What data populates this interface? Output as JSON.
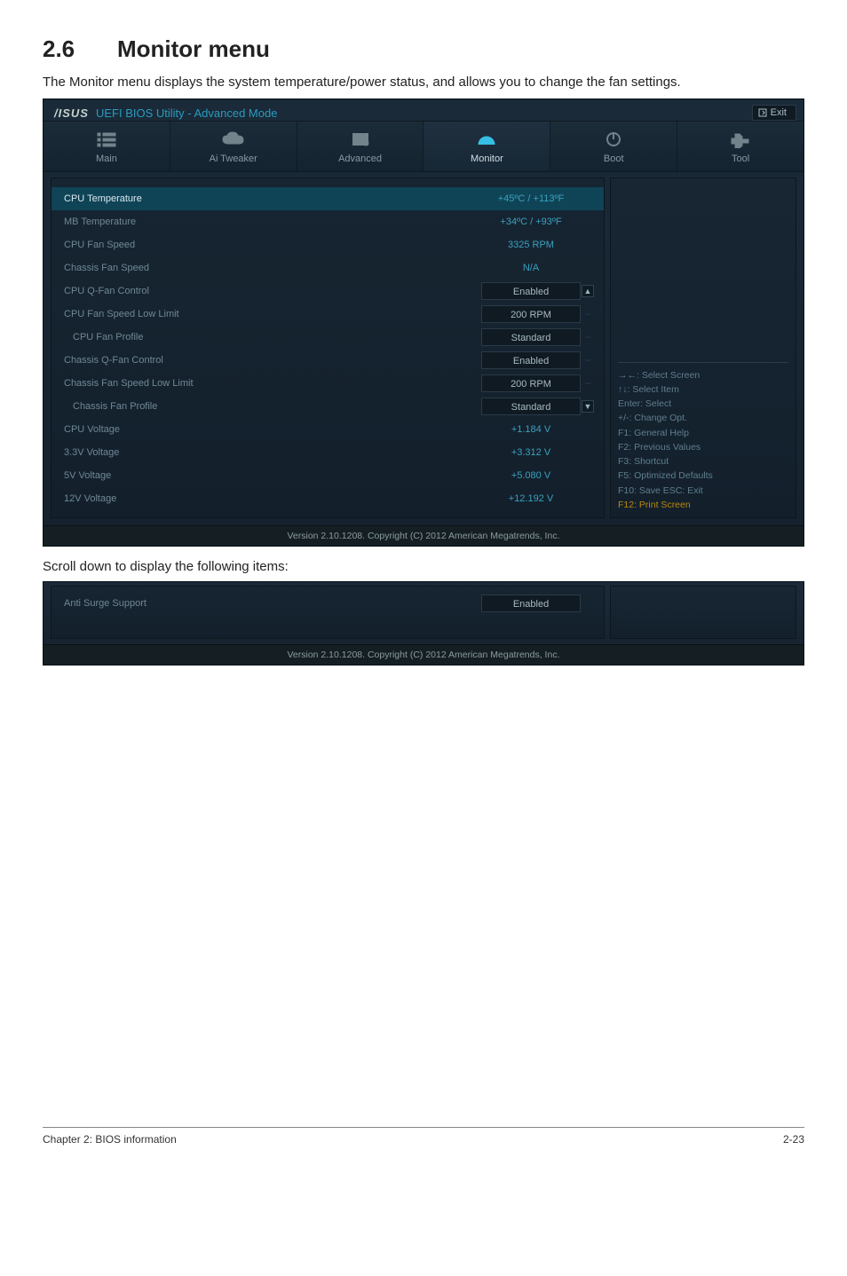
{
  "section": {
    "number": "2.6",
    "title": "Monitor menu"
  },
  "intro": "The Monitor menu displays the system temperature/power status, and allows you to change the fan settings.",
  "scroll_note": "Scroll down to display the following items:",
  "bios": {
    "brand": "/SUS",
    "mode": "UEFI BIOS Utility - Advanced Mode",
    "exit": "Exit",
    "tabs": {
      "main": "Main",
      "ai_tweaker": "Ai  Tweaker",
      "advanced": "Advanced",
      "monitor": "Monitor",
      "boot": "Boot",
      "tool": "Tool"
    },
    "items": [
      {
        "label": "CPU Temperature",
        "value": "+45ºC / +113ºF",
        "type": "text",
        "selected": true
      },
      {
        "label": "MB Temperature",
        "value": "+34ºC / +93ºF",
        "type": "text"
      },
      {
        "label": "CPU Fan Speed",
        "value": "3325 RPM",
        "type": "text"
      },
      {
        "label": "Chassis Fan Speed",
        "value": "N/A",
        "type": "text"
      },
      {
        "label": "CPU Q-Fan Control",
        "value": "Enabled",
        "type": "box"
      },
      {
        "label": "CPU Fan Speed Low Limit",
        "value": "200 RPM",
        "type": "box"
      },
      {
        "label": "CPU Fan Profile",
        "value": "Standard",
        "type": "box",
        "indent": true
      },
      {
        "label": "Chassis Q-Fan Control",
        "value": "Enabled",
        "type": "box"
      },
      {
        "label": "Chassis Fan Speed Low Limit",
        "value": "200 RPM",
        "type": "box"
      },
      {
        "label": "Chassis Fan Profile",
        "value": "Standard",
        "type": "box",
        "indent": true
      },
      {
        "label": "CPU Voltage",
        "value": "+1.184 V",
        "type": "text"
      },
      {
        "label": "3.3V Voltage",
        "value": "+3.312 V",
        "type": "text"
      },
      {
        "label": "5V Voltage",
        "value": "+5.080 V",
        "type": "text"
      },
      {
        "label": "12V Voltage",
        "value": "+12.192 V",
        "type": "text"
      }
    ],
    "help": {
      "l1": "→←:  Select Screen",
      "l2": "↑↓:  Select Item",
      "l3": "Enter:  Select",
      "l4": "+/-:  Change Opt.",
      "l5": "F1:  General Help",
      "l6": "F2:  Previous Values",
      "l7": "F3:  Shortcut",
      "l8": "F5:  Optimized Defaults",
      "l9": "F10:  Save   ESC:  Exit",
      "l10": "F12:  Print Screen"
    },
    "footer": "Version  2.10.1208.   Copyright  (C)  2012  American  Megatrends,  Inc.",
    "extra_item": {
      "label": "Anti Surge Support",
      "value": "Enabled"
    }
  },
  "page_footer": {
    "left": "Chapter 2: BIOS information",
    "right": "2-23"
  }
}
